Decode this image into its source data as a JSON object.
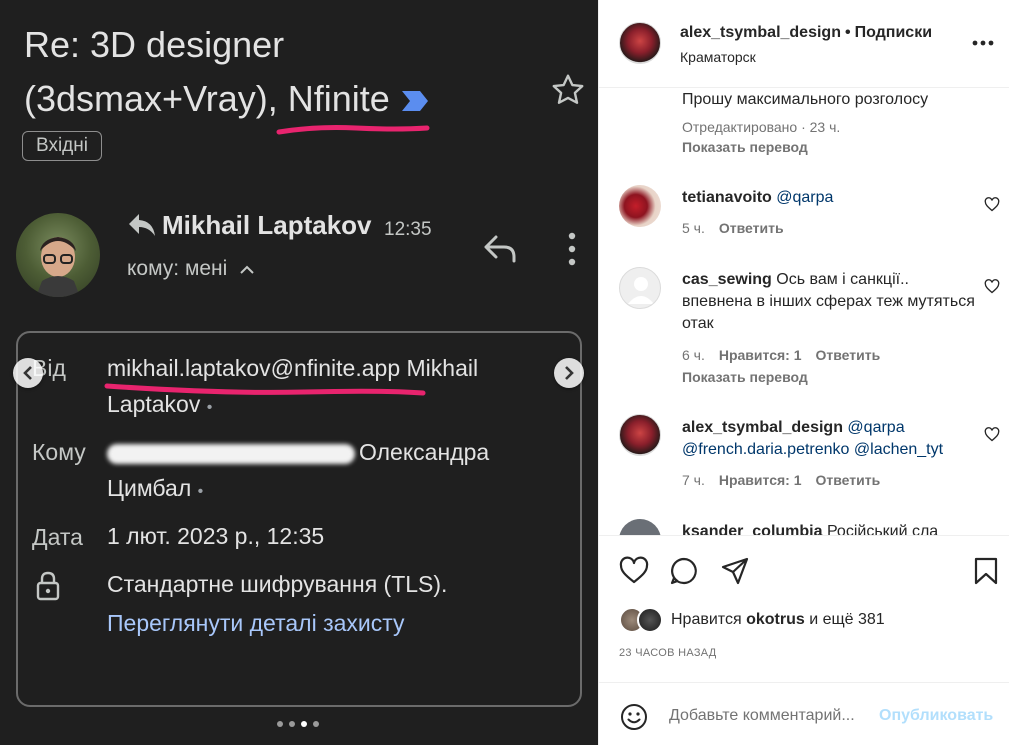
{
  "email": {
    "subject_line1": "Re: 3D designer",
    "subject_line2": "(3dsmax+Vray), Nfinite",
    "label": "Вхідні",
    "sender_name": "Mikhail Laptakov",
    "sender_time": "12:35",
    "to_me": "кому: мені",
    "details": {
      "from_label": "Від",
      "from_value": "mikhail.laptakov@nfinite.app Mikhail Laptakov",
      "to_label": "Кому",
      "to_value": "Олександра Цимбал",
      "date_label": "Дата",
      "date_value": "1 лют. 2023 р., 12:35",
      "encryption": "Стандартне шифрування (TLS).",
      "security_link": "Переглянути деталі захисту"
    },
    "colors": {
      "highlight": "#e8246e",
      "link": "#a8c7fa",
      "important": "#5b8def"
    }
  },
  "ig": {
    "header": {
      "username": "alex_tsymbal_design",
      "separator": "•",
      "follow": "Подписки",
      "location": "Краматорск"
    },
    "comments": [
      {
        "text": "Прошу максимального розголосу",
        "meta": [
          "Отредактировано · 23 ч."
        ],
        "translate": "Показать перевод"
      },
      {
        "user": "tetianavoito",
        "mention": "@qarpa",
        "time": "5 ч.",
        "reply": "Ответить"
      },
      {
        "user": "cas_sewing",
        "text": "Ось вам і санкції.. впевнена в інших сферах теж мутяться отак",
        "time": "6 ч.",
        "likes": "Нравится: 1",
        "reply": "Ответить",
        "translate": "Показать перевод"
      },
      {
        "user": "alex_tsymbal_design",
        "mentions": "@qarpa @french.daria.petrenko @lachen_tyt",
        "time": "7 ч.",
        "likes": "Нравится: 1",
        "reply": "Ответить"
      },
      {
        "user": "ksander_columbia",
        "text": "Російський сла"
      }
    ],
    "liked_prefix": "Нравится",
    "liked_user": "okotrus",
    "liked_suffix": "и ещё 381",
    "time_ago": "23 ЧАСОВ НАЗАД",
    "comment_placeholder": "Добавьте комментарий...",
    "publish_label": "Опубликовать",
    "icons": [
      "heart-icon",
      "comment-icon",
      "share-icon",
      "bookmark-icon",
      "smile-icon",
      "more-horizontal-icon"
    ]
  }
}
